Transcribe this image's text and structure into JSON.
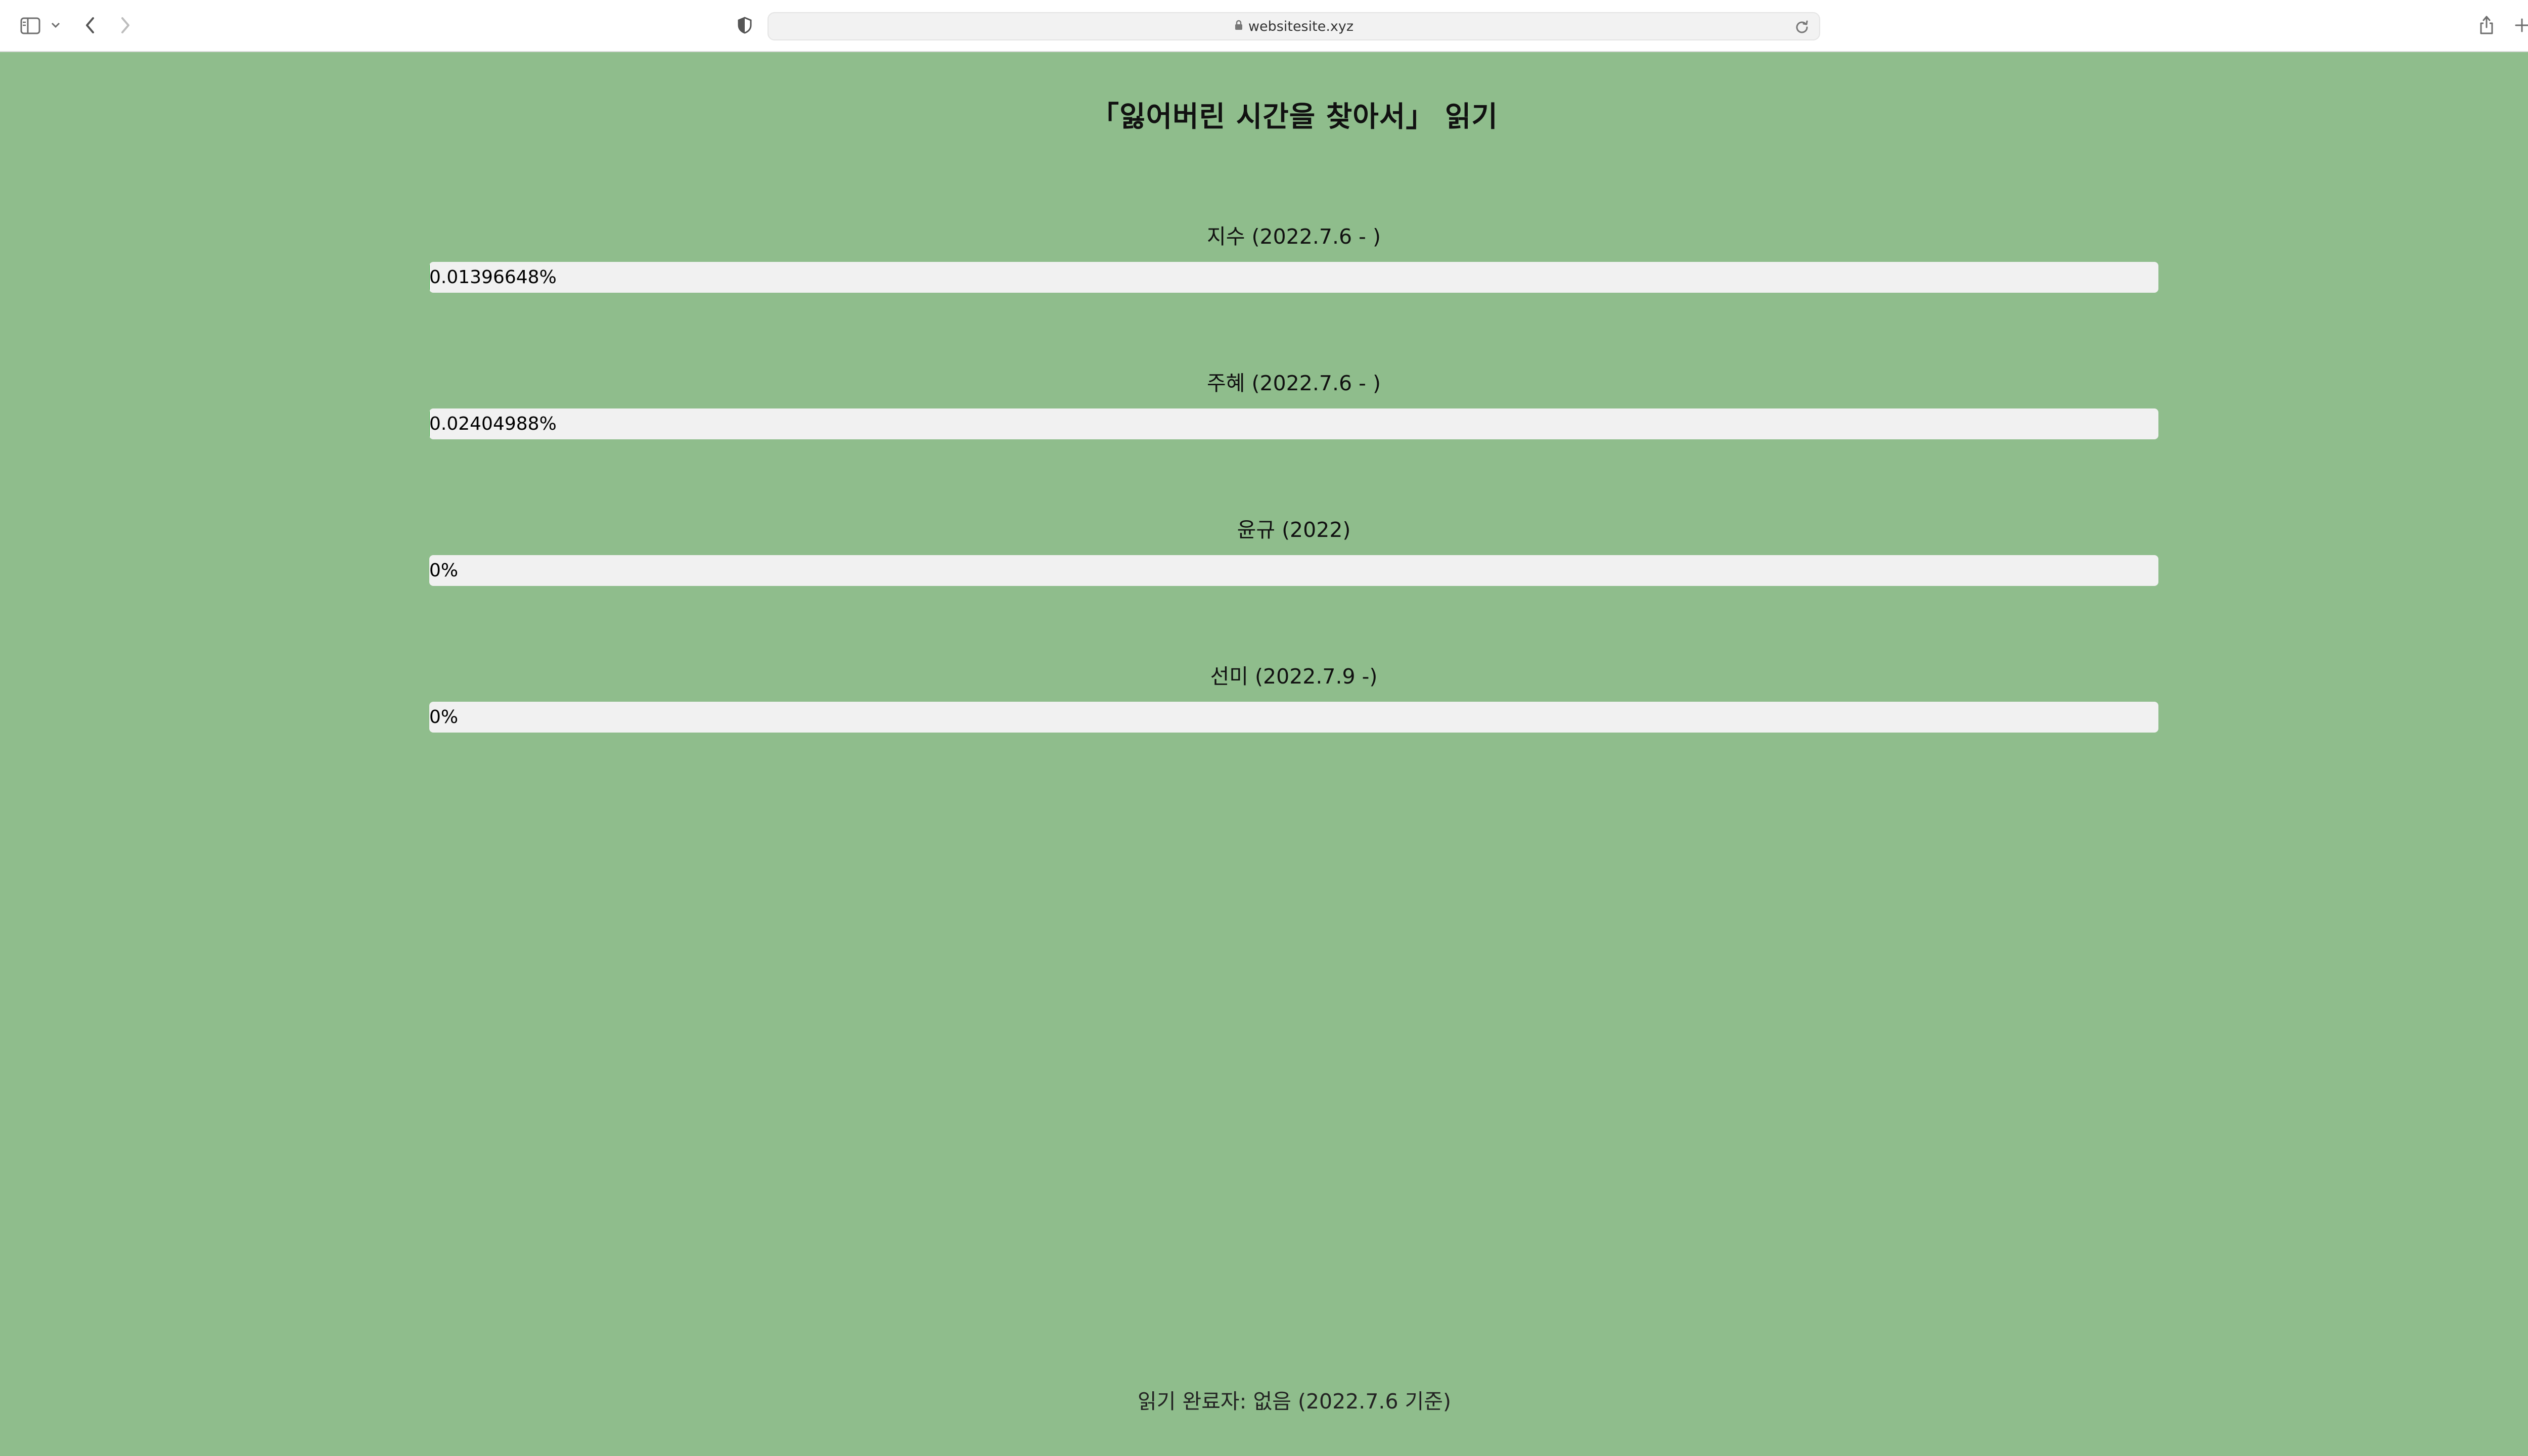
{
  "browser": {
    "url": "websitesite.xyz"
  },
  "page": {
    "title": "「잃어버린 시간을 찾아서」 읽기",
    "background_color": "#8fbd8c",
    "readers": [
      {
        "label": "지수 (2022.7.6 - )",
        "progress_text": "0.01396648%",
        "progress_percent": 0.01396648
      },
      {
        "label": "주혜 (2022.7.6 - )",
        "progress_text": "0.02404988%",
        "progress_percent": 0.02404988
      },
      {
        "label": "윤규 (2022)",
        "progress_text": "0%",
        "progress_percent": 0
      },
      {
        "label": "선미 (2022.7.9 -)",
        "progress_text": "0%",
        "progress_percent": 0
      }
    ],
    "footer": "읽기 완료자: 없음 (2022.7.6 기준)"
  },
  "icons": {
    "sidebar": "sidebar-icon",
    "chevron": "chevron-down-icon",
    "back": "back-arrow-icon",
    "forward": "forward-arrow-icon",
    "privacy": "privacy-shield-icon",
    "lock": "lock-icon",
    "reload": "reload-icon",
    "share": "share-icon",
    "new_tab": "plus-icon",
    "tabs": "tab-overview-icon"
  }
}
